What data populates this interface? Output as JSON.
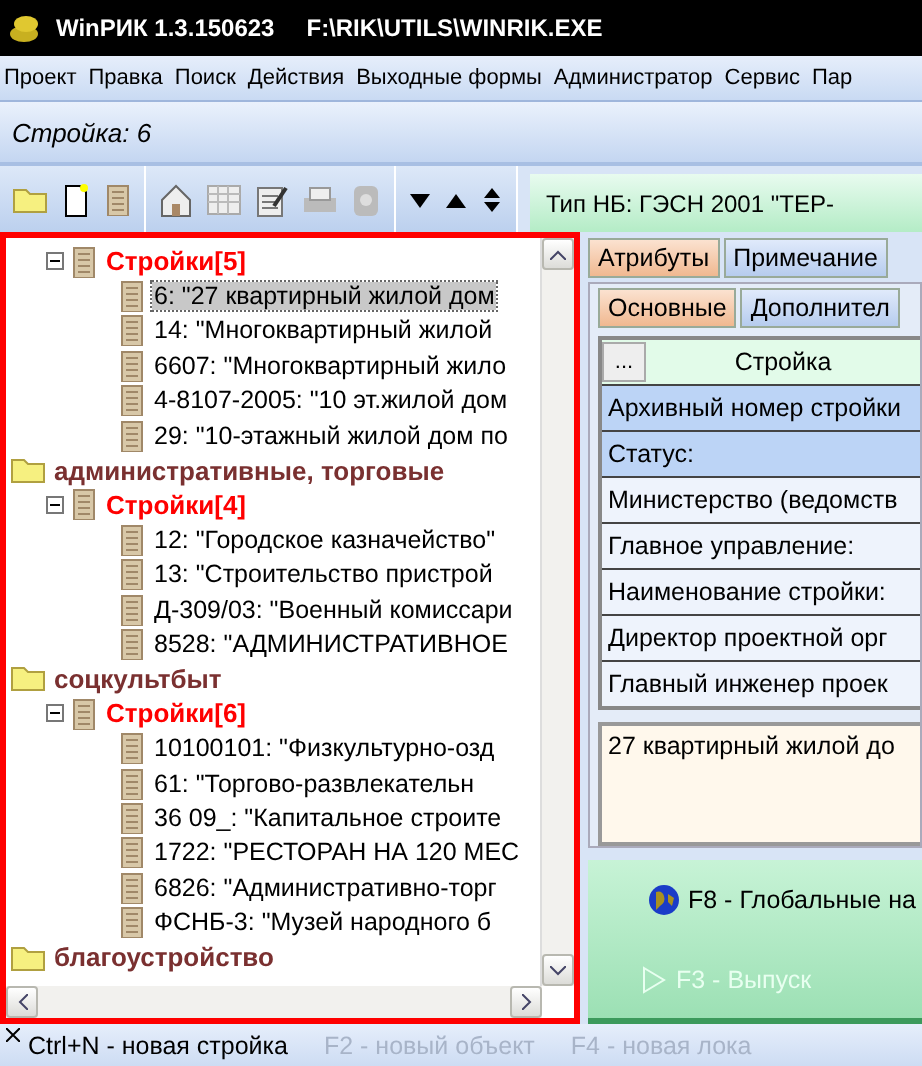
{
  "window": {
    "title": "WinРИК 1.3.150623",
    "path": "F:\\RIK\\UTILS\\WINRIK.EXE"
  },
  "menu": [
    "Проект",
    "Правка",
    "Поиск",
    "Действия",
    "Выходные формы",
    "Администратор",
    "Сервис",
    "Пар"
  ],
  "context": "Стройка: 6",
  "tree": {
    "nodes": [
      {
        "kind": "group",
        "label": "Стройки[5]",
        "expanded": true,
        "children": [
          {
            "kind": "item",
            "label": "6: \"27 квартирный жилой дом",
            "selected": true
          },
          {
            "kind": "item",
            "label": "14: \"Многоквартирный жилой",
            "selected": false
          },
          {
            "kind": "item",
            "label": "6607: \"Многоквартирный жило",
            "selected": false
          },
          {
            "kind": "item",
            "label": "4-8107-2005: \"10 эт.жилой дом",
            "selected": false
          },
          {
            "kind": "item",
            "label": "29: \"10-этажный жилой дом по",
            "selected": false
          }
        ]
      },
      {
        "kind": "folder",
        "label": "административные, торговые",
        "children": [
          {
            "kind": "group",
            "label": "Стройки[4]",
            "expanded": true,
            "children": [
              {
                "kind": "item",
                "label": "12: \"Городское казначейство\"",
                "selected": false
              },
              {
                "kind": "item",
                "label": "13: \"Строительство пристрой",
                "selected": false
              },
              {
                "kind": "item",
                "label": "Д-309/03: \"Военный комиссари",
                "selected": false
              },
              {
                "kind": "item",
                "label": "8528: \"АДМИНИСТРАТИВНОЕ",
                "selected": false
              }
            ]
          }
        ]
      },
      {
        "kind": "folder",
        "label": "соцкультбыт",
        "children": [
          {
            "kind": "group",
            "label": "Стройки[6]",
            "expanded": true,
            "children": [
              {
                "kind": "item",
                "label": "10100101: \"Физкультурно-озд",
                "selected": false
              },
              {
                "kind": "item",
                "label": "61: \"Торгово-развлекательн",
                "selected": false
              },
              {
                "kind": "item",
                "label": "36 09_: \"Капитальное строите",
                "selected": false
              },
              {
                "kind": "item",
                "label": "1722: \"РЕСТОРАН НА 120 МЕС",
                "selected": false
              },
              {
                "kind": "item",
                "label": "6826: \"Административно-торг",
                "selected": false
              },
              {
                "kind": "item",
                "label": "ФСНБ-3: \"Музей народного б",
                "selected": false
              }
            ]
          }
        ]
      },
      {
        "kind": "folder",
        "label": "благоустройство"
      }
    ]
  },
  "right": {
    "norm_base": "Тип НБ: ГЭСН 2001 \"ТЕР-",
    "tabs": [
      {
        "label": "Атрибуты",
        "selected": true
      },
      {
        "label": "Примечание",
        "selected": false
      }
    ],
    "subtabs": [
      {
        "label": "Основные",
        "selected": true
      },
      {
        "label": "Дополнител",
        "selected": false
      }
    ],
    "grid": {
      "button": "...",
      "column": "Стройка",
      "rows": [
        {
          "label": "Архивный номер стройки",
          "selected": true
        },
        {
          "label": "Статус:",
          "selected": true
        },
        {
          "label": "Министерство (ведомств",
          "selected": false
        },
        {
          "label": "Главное управление:",
          "selected": false
        },
        {
          "label": "Наименование стройки:",
          "selected": false
        },
        {
          "label": "Директор проектной орг",
          "selected": false
        },
        {
          "label": "Главный инженер проек",
          "selected": false
        }
      ]
    },
    "memo": "27 квартирный жилой до",
    "actions": [
      {
        "kind": "globe",
        "label": "F8 - Глобальные на",
        "disabled": false
      },
      {
        "kind": "play",
        "label": "F3 - Выпуск",
        "disabled": true
      }
    ]
  },
  "hints": [
    {
      "label": "Ctrl+N - новая стройка",
      "disabled": false
    },
    {
      "label": "F2 - новый объект",
      "disabled": true
    },
    {
      "label": "F4 - новая лока",
      "disabled": true
    }
  ]
}
